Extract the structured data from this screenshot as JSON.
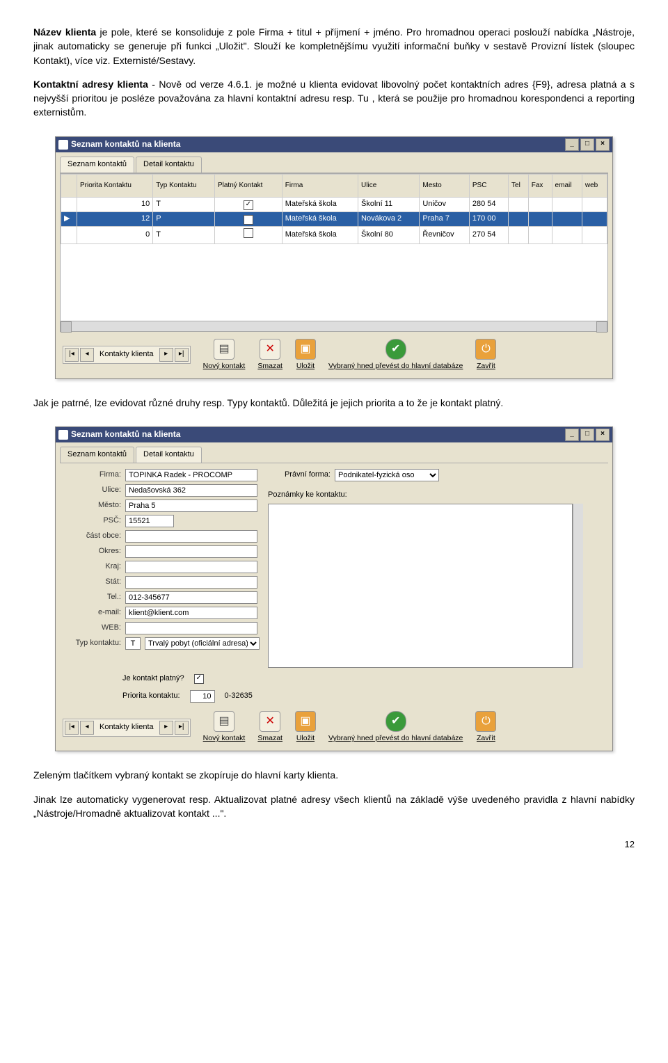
{
  "para1_prefix_bold": "Název klienta",
  "para1_rest": " je pole, které se konsoliduje z pole Firma + titul + příjmení + jméno. Pro hromadnou operaci poslouží nabídka „Nástroje, jinak automaticky se generuje při funkci „Uložit\". Slouží ke kompletnějšímu využití informační buňky v sestavě Provizní lístek (sloupec Kontakt), více viz. Externisté/Sestavy.",
  "para2_bold": "Kontaktní adresy klienta",
  "para2_rest": " - Nově od verze 4.6.1. je možné u klienta evidovat libovolný počet kontaktních adres {F9}, adresa platná a s nejvyšší prioritou je posléze považována za hlavní kontaktní adresu resp. Tu , která se použije pro hromadnou korespondenci a reporting externistům.",
  "para3": "Jak je patrné, lze evidovat různé druhy resp. Typy kontaktů. Důležitá je jejich priorita a to že je kontakt platný.",
  "para4": "Zeleným tlačítkem vybraný kontakt se zkopíruje do hlavní karty klienta.",
  "para5": "Jinak lze automaticky vygenerovat resp. Aktualizovat platné adresy všech klientů na základě výše uvedeného pravidla z hlavní nabídky „Nástroje/Hromadně aktualizovat kontakt ...\".",
  "page_number": "12",
  "win1": {
    "title": "Seznam kontaktů na klienta",
    "tab_active": "Seznam kontaktů",
    "tab_inactive": "Detail kontaktu",
    "columns": [
      "Priorita Kontaktu",
      "Typ Kontaktu",
      "Platný Kontakt",
      "Firma",
      "Ulice",
      "Mesto",
      "PSC",
      "Tel",
      "Fax",
      "email",
      "web"
    ],
    "rows": [
      {
        "marker": " ",
        "priorita": "10",
        "typ": "T",
        "platny": true,
        "firma": "Mateřská škola",
        "ulice": "Školní 11",
        "mesto": "Uničov",
        "psc": "280 54",
        "tel": "",
        "fax": "",
        "email": "",
        "web": ""
      },
      {
        "marker": "▶",
        "priorita": "12",
        "typ": "P",
        "platny": true,
        "firma": "Mateřská škola",
        "ulice": "Novákova 2",
        "mesto": "Praha 7",
        "psc": "170 00",
        "tel": "",
        "fax": "",
        "email": "",
        "web": ""
      },
      {
        "marker": " ",
        "priorita": "0",
        "typ": "T",
        "platny": false,
        "firma": "Mateřská škola",
        "ulice": "Školní 80",
        "mesto": "Řevničov",
        "psc": "270 54",
        "tel": "",
        "fax": "",
        "email": "",
        "web": ""
      }
    ],
    "nav_label": "Kontakty klienta",
    "btn_new": "Nový kontakt",
    "btn_del": "Smazat",
    "btn_save": "Uložit",
    "btn_transfer": "Vybraný hned převést do hlavní databáze",
    "btn_close": "Zavřít"
  },
  "win2": {
    "title": "Seznam kontaktů na klienta",
    "tab_inactive": "Seznam kontaktů",
    "tab_active": "Detail kontaktu",
    "labels": {
      "firma": "Firma:",
      "ulice": "Ulice:",
      "mesto": "Město:",
      "psc": "PSČ:",
      "cast": "část obce:",
      "okres": "Okres:",
      "kraj": "Kraj:",
      "stat": "Stát:",
      "tel": "Tel.:",
      "email": "e-mail:",
      "web": "WEB:",
      "typ": "Typ kontaktu:",
      "pravni": "Právní forma:",
      "poznamky": "Poznámky ke kontaktu:",
      "platny": "Je kontakt platný?",
      "priorita": "Priorita kontaktu:",
      "prioritarange": "0-32635"
    },
    "values": {
      "firma": "TOPINKA Radek - PROCOMP",
      "ulice": "Nedašovská 362",
      "mesto": "Praha 5",
      "psc": "15521",
      "cast": "",
      "okres": "",
      "kraj": "",
      "stat": "",
      "tel": "012-345677",
      "email": "klient@klient.com",
      "web": "",
      "typ_code": "T",
      "typ_text": "Trvalý pobyt (oficiální adresa)",
      "pravni": "Podnikatel-fyzická oso",
      "platny": true,
      "priorita": "10"
    },
    "nav_label": "Kontakty klienta",
    "btn_new": "Nový kontakt",
    "btn_del": "Smazat",
    "btn_save": "Uložit",
    "btn_transfer": "Vybraný hned převést do hlavní databáze",
    "btn_close": "Zavřít"
  }
}
